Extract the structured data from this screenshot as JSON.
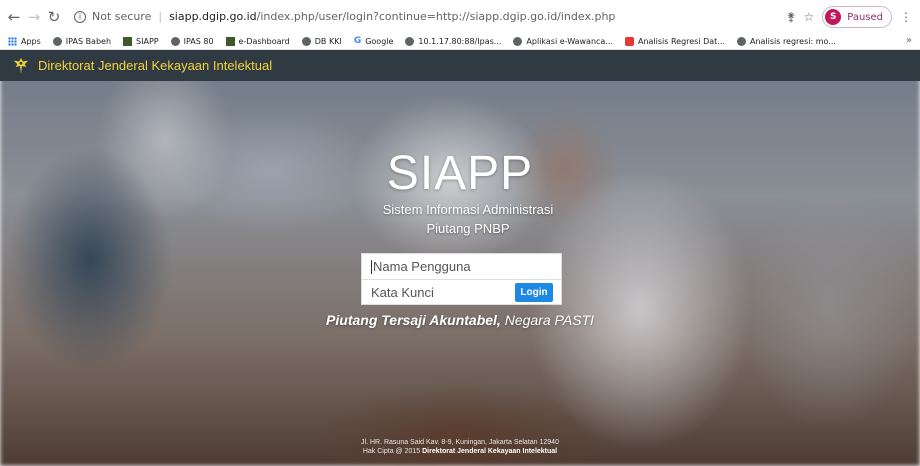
{
  "browser": {
    "url_security": "Not secure",
    "url_domain": "siapp.dgip.go.id",
    "url_path": "/index.php/user/login?continue=http://siapp.dgip.go.id/index.php",
    "profile_initial": "S",
    "profile_status": "Paused",
    "bookmarks": [
      {
        "label": "Apps",
        "icon": "apps-icon"
      },
      {
        "label": "IPAS Babeh",
        "icon": "globe-icon"
      },
      {
        "label": "SIAPP",
        "icon": "site-icon"
      },
      {
        "label": "IPAS 80",
        "icon": "globe-icon"
      },
      {
        "label": "e-Dashboard",
        "icon": "site-icon"
      },
      {
        "label": "DB KKI",
        "icon": "globe-icon"
      },
      {
        "label": "Google",
        "icon": "google-icon"
      },
      {
        "label": "10.1.17.80:88/Ipas...",
        "icon": "globe-icon"
      },
      {
        "label": "Aplikasi e-Wawanca...",
        "icon": "globe-icon"
      },
      {
        "label": "Analisis Regresi Dat...",
        "icon": "youtube-icon"
      },
      {
        "label": "Analisis regresi: mo...",
        "icon": "globe-icon"
      }
    ]
  },
  "header": {
    "title": "Direktorat Jenderal Kekayaan Intelektual"
  },
  "hero": {
    "title": "SIAPP",
    "subtitle_line1": "Sistem Informasi Administrasi",
    "subtitle_line2": "Piutang PNBP"
  },
  "login": {
    "username_placeholder": "Nama Pengguna",
    "password_placeholder": "Kata Kunci",
    "button_label": "Login"
  },
  "tagline_part1": "Piutang Tersaji Akuntabel,",
  "tagline_part2": "Negara PASTI",
  "footer": {
    "address": "Jl. HR. Rasuna Said Kav. 8-9, Kuningan, Jakarta Selatan 12940",
    "copyright_prefix": "Hak Cipta @ 2015",
    "copyright_org": "Direktorat Jenderal Kekayaan Intelektual"
  },
  "colors": {
    "header_bg": "#2f3a43",
    "header_title": "#f2d33b",
    "login_button": "#1e88e5"
  }
}
